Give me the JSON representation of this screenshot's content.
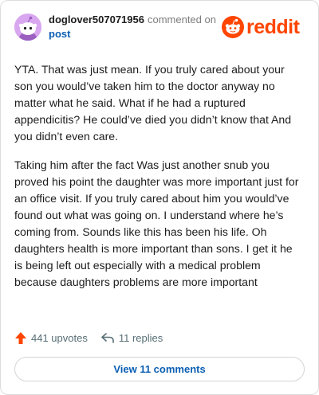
{
  "header": {
    "username": "doglover507071956",
    "action_text": "commented on",
    "post_label": "post",
    "logo_text": "reddit"
  },
  "comment": {
    "paragraphs": [
      "YTA. That was just mean. If you truly cared about your son you would’ve taken him to the doctor anyway no matter what he said. What if he had a ruptured appendicitis? He could’ve died you didn’t know that And you didn’t even care.",
      "Taking him after the fact Was just another snub you proved his point the daughter was more important just for an office visit. If you truly cared about him you would’ve found out what was going on. I understand where he’s coming from. Sounds like this has been his life. Oh daughters health is more important than sons. I get it he is being left out especially with a medical problem because daughters problems are more important"
    ]
  },
  "footer": {
    "upvotes": "441 upvotes",
    "replies": "11 replies",
    "view_comments": "View 11 comments"
  },
  "colors": {
    "brand": "#ff4500",
    "link": "#0b5fb3",
    "avatar_bg": "#d9a7f0",
    "muted": "#576f76"
  },
  "icons": {
    "upvote": "upvote-arrow-icon",
    "reply": "reply-arrow-icon",
    "logo": "reddit-snoo-icon",
    "avatar": "snoo-avatar-icon"
  }
}
